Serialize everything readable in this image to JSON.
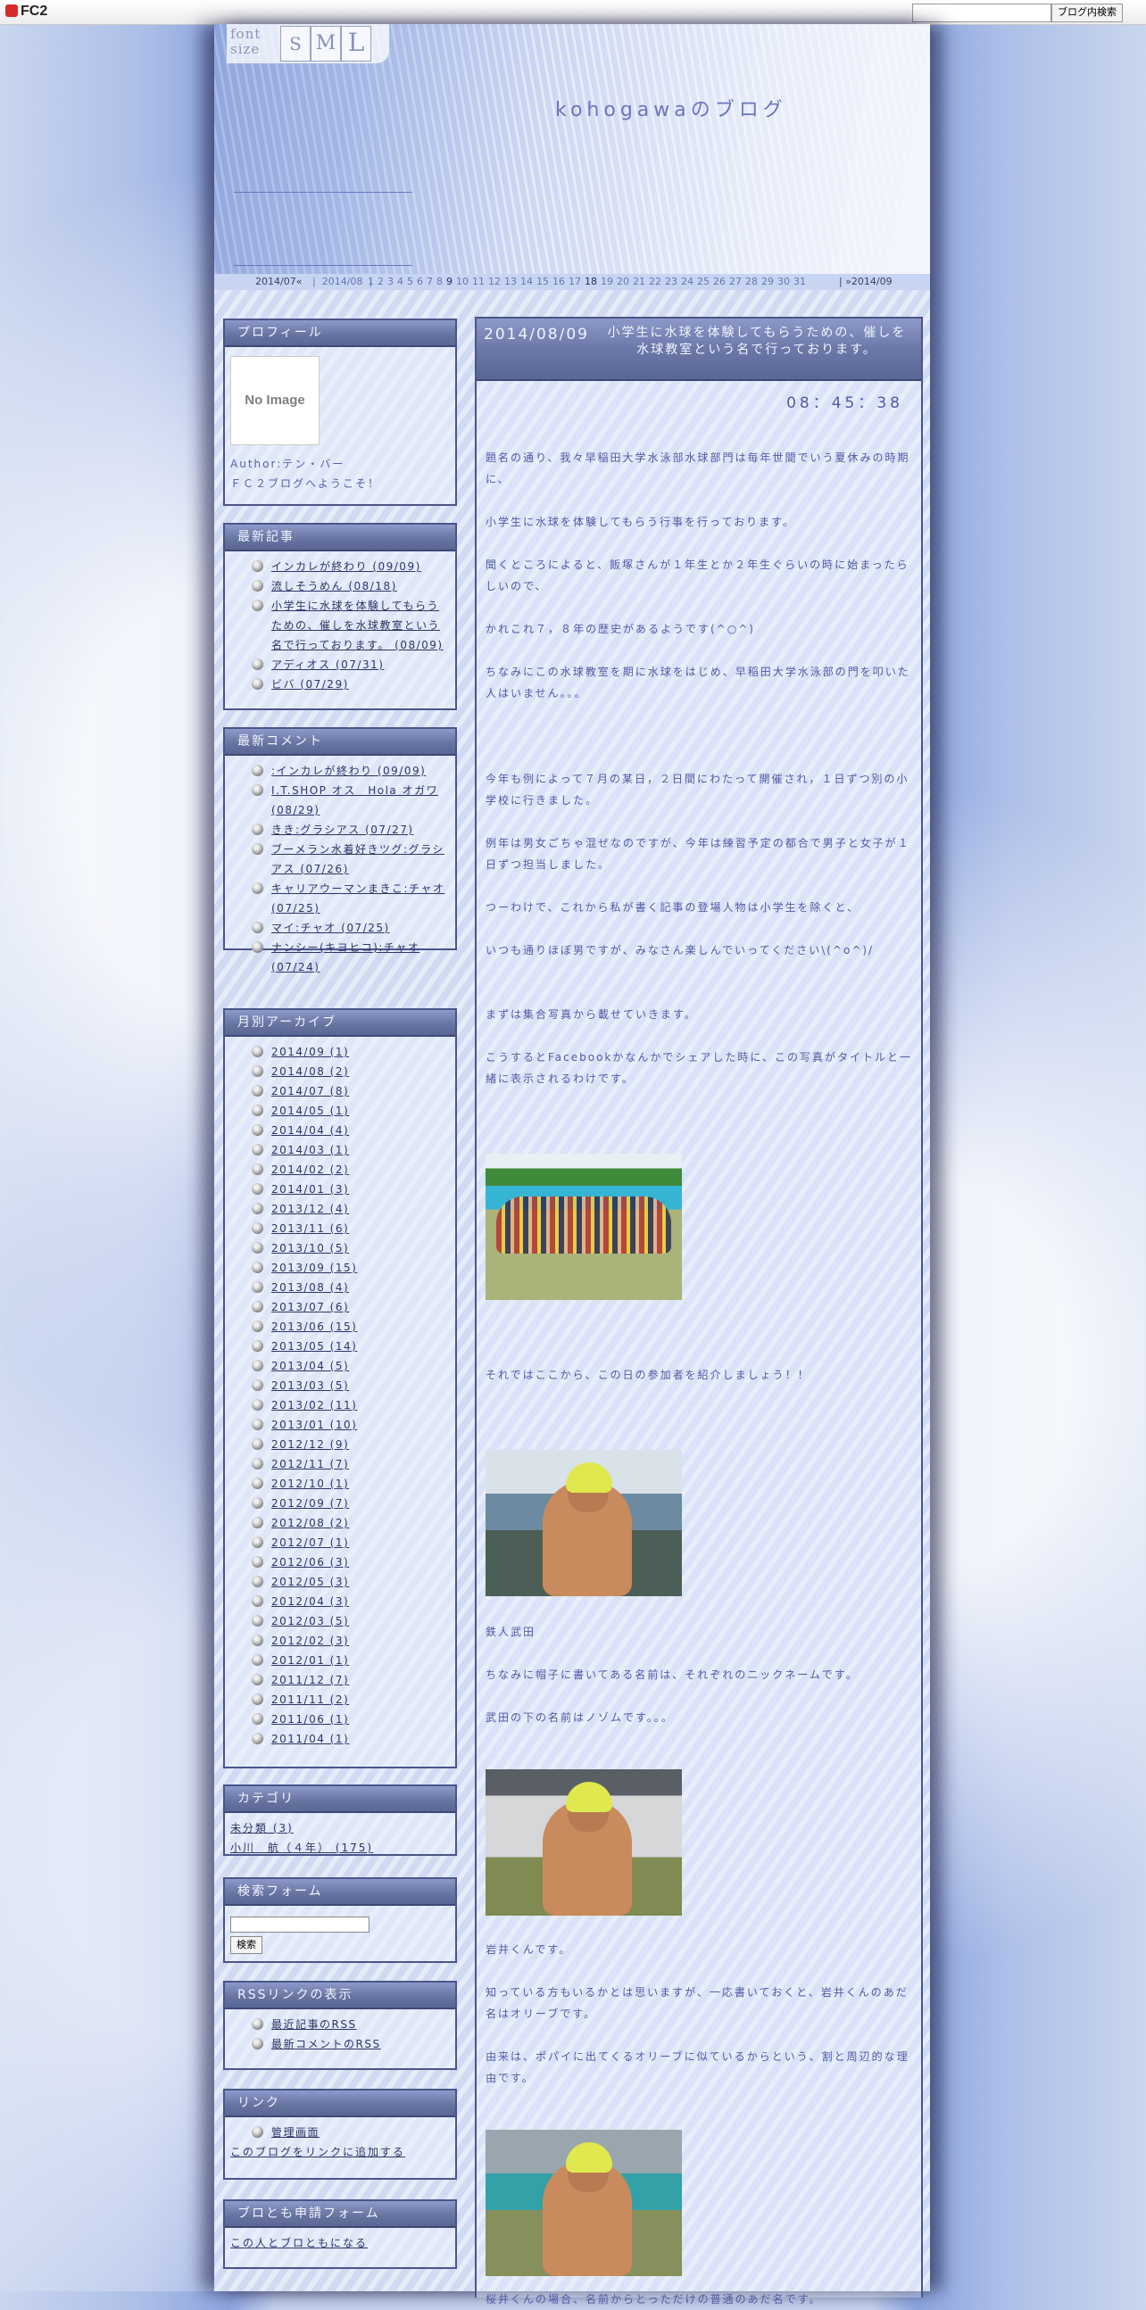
{
  "fc2bar": {
    "logo": "FC2",
    "search_placeholder": "",
    "search_button": "ブログ内検索"
  },
  "header": {
    "font_label_1": "font",
    "font_label_2": "size",
    "fs_small": "S",
    "fs_medium": "M",
    "fs_large": "L",
    "blog_title": "kohogawaのブログ"
  },
  "calendar": {
    "prev": "2014/07«",
    "current": "2014/08",
    "days": [
      "1",
      "2",
      "3",
      "4",
      "5",
      "6",
      "7",
      "8",
      "9",
      "10",
      "11",
      "12",
      "13",
      "14",
      "15",
      "16",
      "17",
      "18",
      "19",
      "20",
      "21",
      "22",
      "23",
      "24",
      "25",
      "26",
      "27",
      "28",
      "29",
      "30",
      "31"
    ],
    "days_with_posts": [
      "9",
      "18"
    ],
    "next": "»2014/09"
  },
  "profile": {
    "title": "プロフィール",
    "noimage": "No Image",
    "author": "Author:テン・バー",
    "welcome": "ＦＣ２ブログへようこそ！"
  },
  "recent_entries": {
    "title": "最新記事",
    "items": [
      "インカレが終わり (09/09)",
      "流しそうめん (08/18)",
      "小学生に水球を体験してもらうための、催しを水球教室という名で行っております。 (08/09)",
      "アディオス (07/31)",
      "ビバ (07/29)"
    ]
  },
  "recent_comments": {
    "title": "最新コメント",
    "items": [
      ":インカレが終わり (09/09)",
      "I.T.SHOP オス　Hola オガワ (08/29)",
      "きき:グラシアス (07/27)",
      "ブーメラン水着好きツグ:グラシアス (07/26)",
      "キャリアウーマンまきこ:チャオ (07/25)",
      "マイ:チャオ (07/25)",
      "ナンシー(キヨヒコ):チャオ (07/24)"
    ]
  },
  "archives": {
    "title": "月別アーカイブ",
    "items": [
      "2014/09 (1)",
      "2014/08 (2)",
      "2014/07 (8)",
      "2014/05 (1)",
      "2014/04 (4)",
      "2014/03 (1)",
      "2014/02 (2)",
      "2014/01 (3)",
      "2013/12 (4)",
      "2013/11 (6)",
      "2013/10 (5)",
      "2013/09 (15)",
      "2013/08 (4)",
      "2013/07 (6)",
      "2013/06 (15)",
      "2013/05 (14)",
      "2013/04 (5)",
      "2013/03 (5)",
      "2013/02 (11)",
      "2013/01 (10)",
      "2012/12 (9)",
      "2012/11 (7)",
      "2012/10 (1)",
      "2012/09 (7)",
      "2012/08 (2)",
      "2012/07 (1)",
      "2012/06 (3)",
      "2012/05 (3)",
      "2012/04 (3)",
      "2012/03 (5)",
      "2012/02 (3)",
      "2012/01 (1)",
      "2011/12 (7)",
      "2011/11 (2)",
      "2011/06 (1)",
      "2011/04 (1)"
    ]
  },
  "categories": {
    "title": "カテゴリ",
    "items": [
      "未分類 (3)",
      "小川　航（４年） (175)"
    ]
  },
  "search_form": {
    "title": "検索フォーム",
    "button": "検索"
  },
  "rss": {
    "title": "RSSリンクの表示",
    "items": [
      "最近記事のRSS",
      "最新コメントのRSS"
    ]
  },
  "links": {
    "title": "リンク",
    "items": [
      "管理画面"
    ],
    "add_link": "このブログをリンクに追加する"
  },
  "friend": {
    "title": "ブロとも申請フォーム",
    "link": "この人とブロともになる"
  },
  "entry": {
    "date": "2014/08/09",
    "title": "小学生に水球を体験してもらうための、催しを水球教室という名で行っております。",
    "time": "08：45：38",
    "paragraphs": [
      "題名の通り、我々早稲田大学水泳部水球部門は毎年世間でいう夏休みの時期に、",
      "小学生に水球を体験してもらう行事を行っております。",
      "聞くところによると、飯塚さんが１年生とか２年生ぐらいの時に始まったらしいので、",
      "かれこれ７，８年の歴史があるようです(^○^)",
      "ちなみにこの水球教室を期に水球をはじめ、早稲田大学水泳部の門を叩いた人はいません。。。",
      "今年も例によって７月の某日，２日間にわたって開催され，１日ずつ別の小学校に行きました。",
      "例年は男女ごちゃ混ぜなのですが、今年は練習予定の都合で男子と女子が１日ずつ担当しました。",
      "つーわけで、これから私が書く記事の登場人物は小学生を除くと、",
      "いつも通りほぼ男ですが、みなさん楽しんでいってください\\(^o^)/",
      "まずは集合写真から載せていきます。",
      "こうするとFacebookかなんかでシェアした時に、この写真がタイトルと一緒に表示されるわけです。",
      "それではここから、この日の参加者を紹介しましょう！！",
      "鉄人武田",
      "ちなみに帽子に書いてある名前は、それぞれのニックネームです。",
      "武田の下の名前はノゾムです。。。",
      "岩井くんです。",
      "知っている方もいるかとは思いますが、一応書いておくと、岩井くんのあだ名はオリーブです。",
      "由来は、ポパイに出てくるオリーブに似ているからという、割と周辺的な理由です。",
      "桜井くんの場合、名前からとっただけの普通のあだ名です。"
    ]
  }
}
